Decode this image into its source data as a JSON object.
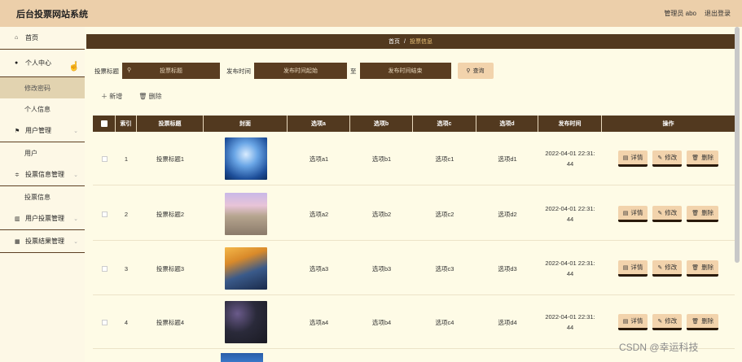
{
  "app_title": "后台投票网站系统",
  "header": {
    "admin_label": "管理员 abo",
    "logout_label": "退出登录"
  },
  "sidebar": {
    "home": "首页",
    "personal_center": "个人中心",
    "change_password": "修改密码",
    "personal_info": "个人信息",
    "user_management": "用户管理",
    "user": "用户",
    "vote_info_management": "投票信息管理",
    "vote_info": "投票信息",
    "user_vote_management": "用户投票管理",
    "vote_result_management": "投票结果管理"
  },
  "breadcrumb": {
    "home": "首页",
    "separator": "/",
    "current": "投票信息"
  },
  "search": {
    "title_label": "投票标题",
    "title_placeholder": "投票标题",
    "time_label": "发布时间",
    "time_start_placeholder": "发布时间起始",
    "time_to": "至",
    "time_end_placeholder": "发布时间结束",
    "query_button": "查询"
  },
  "toolbar": {
    "add_label": "新增",
    "delete_label": "删除"
  },
  "table": {
    "columns": [
      "索引",
      "投票标题",
      "封面",
      "选项a",
      "选项b",
      "选项c",
      "选项d",
      "发布时间",
      "操作"
    ],
    "rows": [
      {
        "index": "1",
        "title": "投票标题1",
        "a": "选项a1",
        "b": "选项b1",
        "c": "选项c1",
        "d": "选项d1",
        "date1": "2022-04-01 22:31:",
        "date2": "44"
      },
      {
        "index": "2",
        "title": "投票标题2",
        "a": "选项a2",
        "b": "选项b2",
        "c": "选项c2",
        "d": "选项d2",
        "date1": "2022-04-01 22:31:",
        "date2": "44"
      },
      {
        "index": "3",
        "title": "投票标题3",
        "a": "选项a3",
        "b": "选项b3",
        "c": "选项c3",
        "d": "选项d3",
        "date1": "2022-04-01 22:31:",
        "date2": "44"
      },
      {
        "index": "4",
        "title": "投票标题4",
        "a": "选项a4",
        "b": "选项b4",
        "c": "选项c4",
        "d": "选项d4",
        "date1": "2022-04-01 22:31:",
        "date2": "44"
      }
    ],
    "ops": {
      "detail": "详情",
      "edit": "修改",
      "delete": "删除"
    }
  },
  "watermark": "CSDN @幸运科技",
  "colors": {
    "dark_brown": "#52391f",
    "tan": "#f2d3ac",
    "cream": "#fefbe6",
    "header_bg": "#eccfaa"
  }
}
